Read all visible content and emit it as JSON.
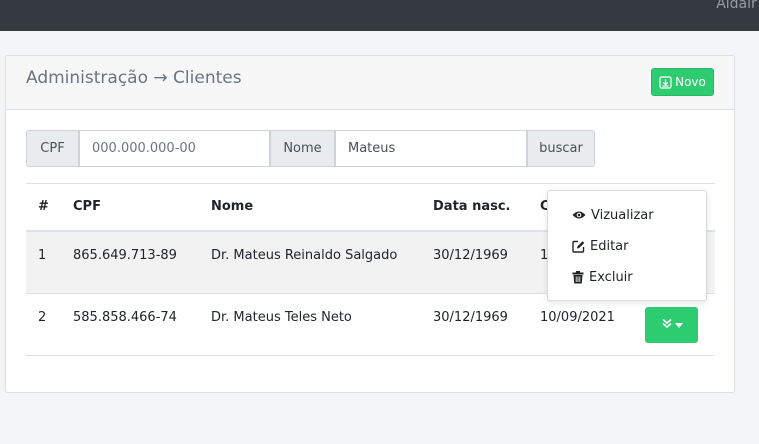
{
  "navbar": {
    "user_name": "Aldair C"
  },
  "header": {
    "title": "Administração → Clientes",
    "new_button_label": "Novo"
  },
  "filter": {
    "cpf_label": "CPF",
    "cpf_placeholder": "000.000.000-00",
    "cpf_value": "",
    "name_label": "Nome",
    "name_value": "Mateus",
    "search_button_label": "buscar"
  },
  "table": {
    "columns": [
      "#",
      "CPF",
      "Nome",
      "Data nasc.",
      "C"
    ],
    "rows": [
      {
        "index": "1",
        "cpf": "865.649.713-89",
        "name": "Dr. Mateus Reinaldo Salgado",
        "birth_date": "30/12/1969",
        "created": "1"
      },
      {
        "index": "2",
        "cpf": "585.858.466-74",
        "name": "Dr. Mateus Teles Neto",
        "birth_date": "30/12/1969",
        "created": "10/09/2021"
      }
    ]
  },
  "row_menu": {
    "items": [
      {
        "label": "Vizualizar",
        "icon": "eye-icon"
      },
      {
        "label": "Editar",
        "icon": "edit-icon"
      },
      {
        "label": "Excluir",
        "icon": "trash-icon"
      }
    ]
  },
  "colors": {
    "primary_green": "#2ecc71",
    "navbar_dark": "#343a40"
  }
}
